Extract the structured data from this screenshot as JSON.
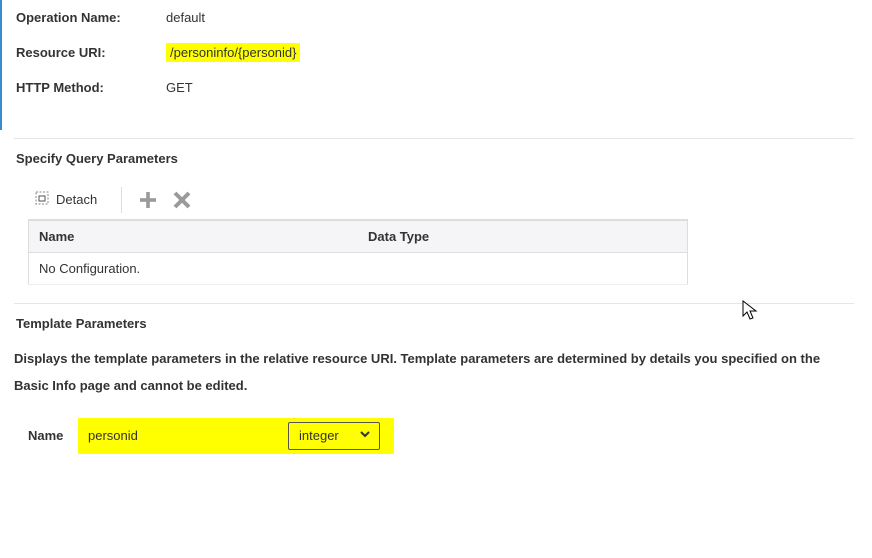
{
  "fields": {
    "opNameLabel": "Operation Name:",
    "opNameValue": "default",
    "resourceUriLabel": "Resource URI:",
    "resourceUriValue": "/personinfo/{personid}",
    "httpMethodLabel": "HTTP Method:",
    "httpMethodValue": "GET"
  },
  "query": {
    "sectionTitle": "Specify Query Parameters",
    "detach": "Detach",
    "columns": {
      "name": "Name",
      "dataType": "Data Type"
    },
    "empty": "No Configuration."
  },
  "template": {
    "sectionTitle": "Template Parameters",
    "description": "Displays the template parameters in the relative resource URI. Template parameters are determined by details you specified on the Basic Info page and cannot be edited.",
    "nameLabel": "Name",
    "paramName": "personid",
    "paramType": "integer"
  }
}
